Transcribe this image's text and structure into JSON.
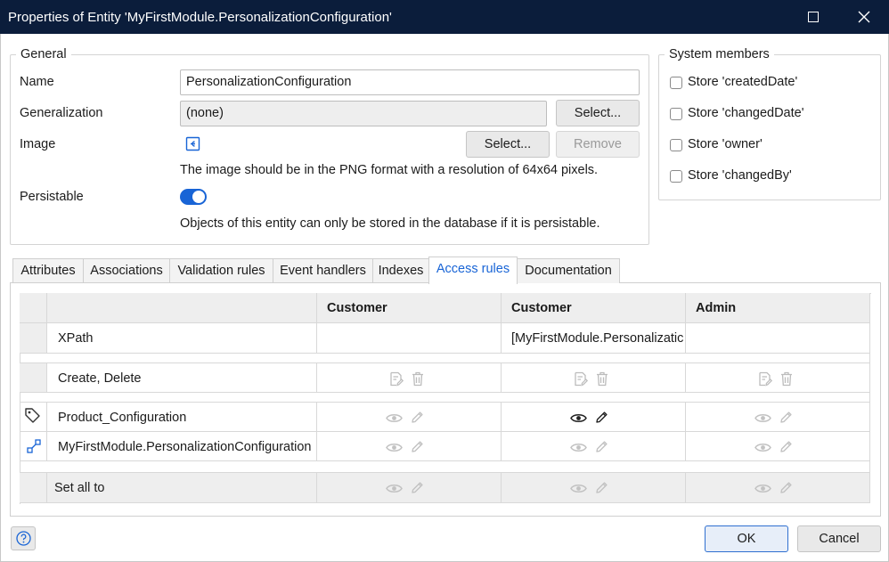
{
  "window": {
    "title": "Properties of Entity 'MyFirstModule.PersonalizationConfiguration'",
    "maximize_icon": "maximize-icon",
    "close_icon": "close-icon"
  },
  "general": {
    "legend": "General",
    "name_label": "Name",
    "name_value": "PersonalizationConfiguration",
    "generalization_label": "Generalization",
    "generalization_value": "(none)",
    "generalization_select": "Select...",
    "image_label": "Image",
    "image_icon": "image-placeholder-icon",
    "image_select": "Select...",
    "image_remove": "Remove",
    "image_hint": "The image should be in the PNG format with a resolution of 64x64 pixels.",
    "persistable_label": "Persistable",
    "persistable_on": true,
    "persistable_hint": "Objects of this entity can only be stored in the database if it is persistable."
  },
  "system_members": {
    "legend": "System members",
    "items": [
      "Store 'createdDate'",
      "Store 'changedDate'",
      "Store 'owner'",
      "Store 'changedBy'"
    ]
  },
  "tabs": [
    "Attributes",
    "Associations",
    "Validation rules",
    "Event handlers",
    "Indexes",
    "Access rules",
    "Documentation"
  ],
  "active_tab": "Access rules",
  "access_grid": {
    "columns": [
      "Customer",
      "Customer",
      "Admin"
    ],
    "rows": {
      "xpath": {
        "label": "XPath",
        "values": [
          "",
          "[MyFirstModule.Personalizatic",
          ""
        ]
      },
      "create_delete": {
        "label": "Create, Delete"
      },
      "attribute": {
        "label": "Product_Configuration",
        "icon": "tag-icon"
      },
      "association": {
        "label": "MyFirstModule.PersonalizationConfiguration",
        "icon": "association-icon"
      },
      "set_all": {
        "label": "Set all to"
      }
    }
  },
  "footer": {
    "help_icon": "help-icon",
    "ok": "OK",
    "cancel": "Cancel"
  }
}
